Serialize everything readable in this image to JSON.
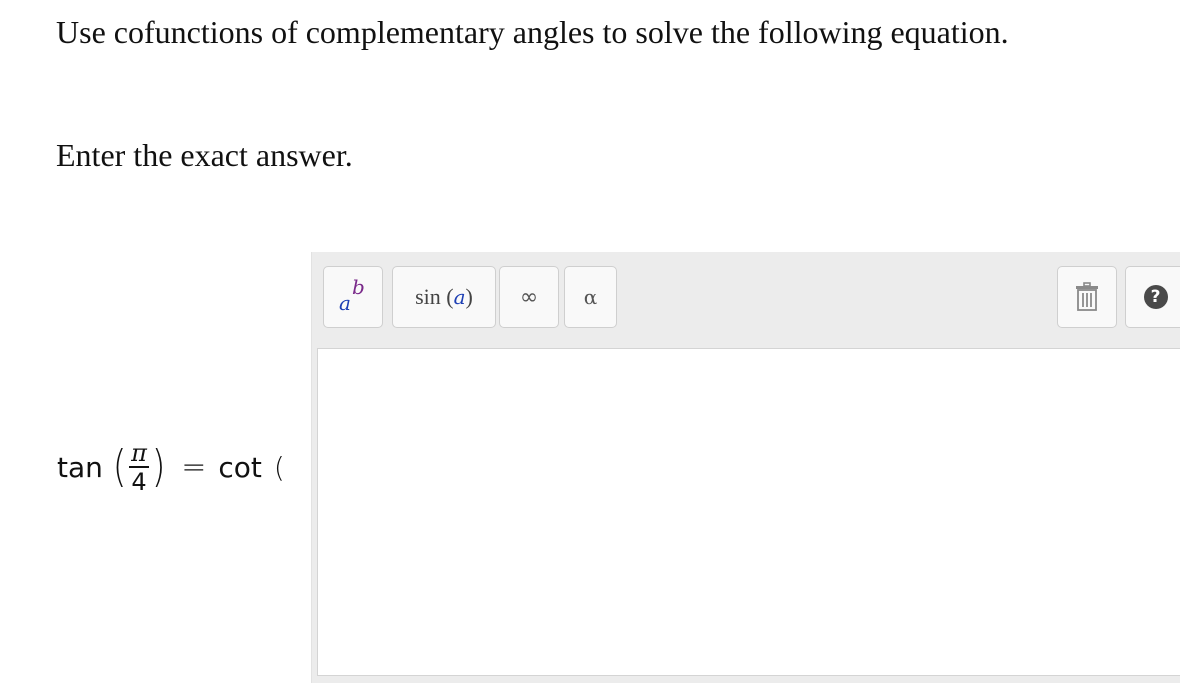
{
  "question": {
    "instruction": "Use cofunctions of complementary angles to solve the following equation.",
    "prompt": "Enter the exact answer."
  },
  "equation": {
    "lhs_function": "tan",
    "open_paren": "(",
    "numerator": "π",
    "denominator": "4",
    "close_paren": ")",
    "equals": "=",
    "rhs_function": "cot",
    "rhs_open_paren": "("
  },
  "editor": {
    "toolbar": {
      "power_button": {
        "base": "a",
        "exponent": "b"
      },
      "function_button": {
        "prefix": "sin (",
        "argument": "a",
        "suffix": ")"
      },
      "infinity_button": {
        "symbol": "∞"
      },
      "greek_button": {
        "symbol": "α"
      },
      "trash_button": {
        "icon": "trash-icon"
      },
      "help_button": {
        "icon": "help-icon",
        "symbol": "?"
      }
    },
    "input": {
      "value": ""
    }
  },
  "colors": {
    "toolbar_bg": "#ececec",
    "button_bg": "#f9f9f9",
    "button_border": "#cfcfcf",
    "variable_base": "#1d3fb4",
    "variable_exponent": "#7a2a8a",
    "help_icon_bg": "#4a4a4a"
  }
}
